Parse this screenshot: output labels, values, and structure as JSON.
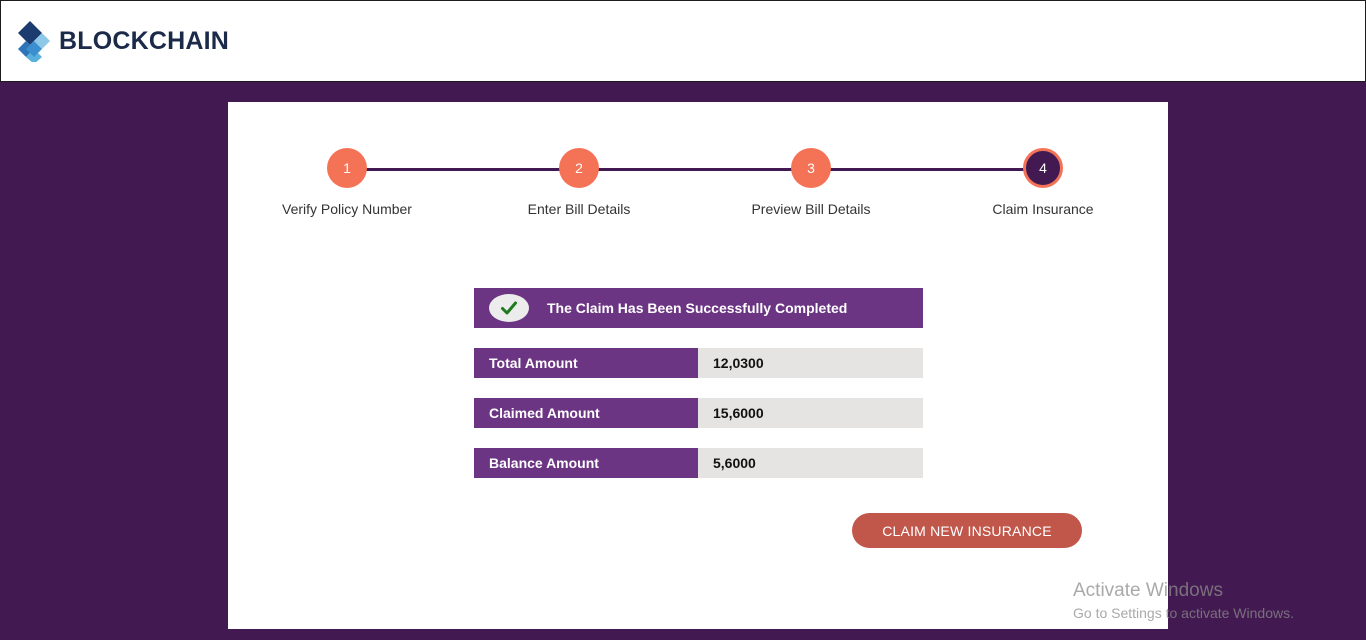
{
  "header": {
    "logo_text": "BLOCKCHAIN",
    "logo_colors": [
      "#1c3b6e",
      "#2d74b9",
      "#5ab0dc",
      "#8dc8e8"
    ]
  },
  "steps": [
    {
      "number": "1",
      "label": "Verify Policy Number",
      "state": "completed"
    },
    {
      "number": "2",
      "label": "Enter Bill Details",
      "state": "completed"
    },
    {
      "number": "3",
      "label": "Preview Bill Details",
      "state": "completed"
    },
    {
      "number": "4",
      "label": "Claim Insurance",
      "state": "active"
    }
  ],
  "success": {
    "icon": "check-icon",
    "message": "The Claim Has Been Successfully Completed"
  },
  "amounts": [
    {
      "label": "Total Amount",
      "value": "12,0300"
    },
    {
      "label": "Claimed Amount",
      "value": "15,6000"
    },
    {
      "label": "Balance Amount",
      "value": "5,6000"
    }
  ],
  "actions": {
    "claim_new_label": "CLAIM NEW INSURANCE"
  },
  "watermark": {
    "title": "Activate Windows",
    "subtitle": "Go to Settings to activate Windows."
  },
  "colors": {
    "background": "#421a51",
    "primary_purple": "#6c3584",
    "step_accent": "#f47357",
    "button": "#c0574a",
    "value_bg": "#e5e4e3",
    "success_check": "#1e7a1e"
  }
}
